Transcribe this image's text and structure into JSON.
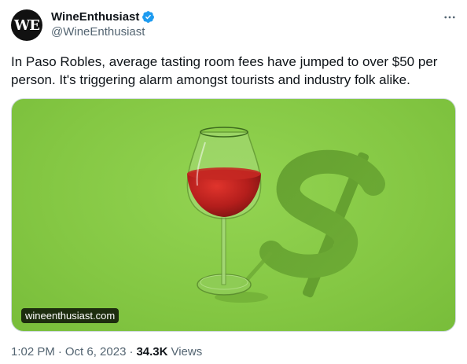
{
  "author": {
    "avatar_text": "WE",
    "display_name": "WineEnthusiast",
    "handle": "@WineEnthusiast",
    "verified_color": "#1d9bf0"
  },
  "tweet": {
    "text": "In Paso Robles, average tasting room fees have jumped to over $50 per person. It's triggering alarm amongst tourists and industry folk alike.",
    "media_link": "wineenthusiast.com"
  },
  "meta": {
    "time": "1:02 PM",
    "separator": "·",
    "date": "Oct 6, 2023",
    "views_count": "34.3K",
    "views_label": "Views"
  },
  "icons": {
    "more": "more-horizontal-icon",
    "verified": "verified-badge-icon"
  }
}
